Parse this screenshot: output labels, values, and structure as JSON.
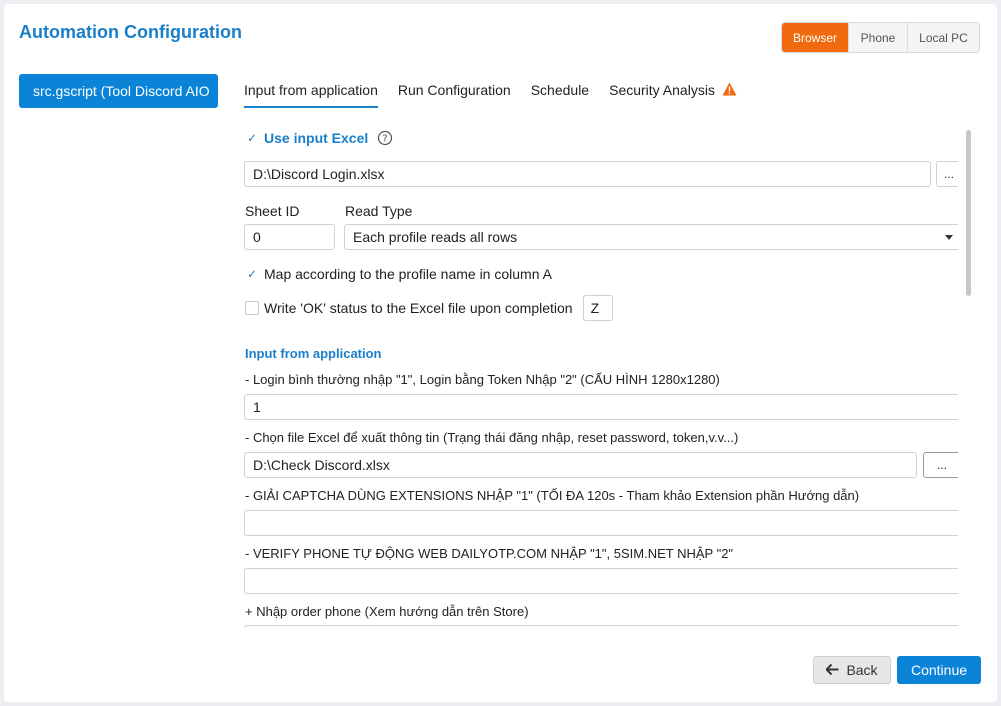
{
  "header": {
    "title": "Automation Configuration"
  },
  "env_tabs": [
    "Browser",
    "Phone",
    "Local PC"
  ],
  "env_active": "Browser",
  "script": {
    "name": "src.gscript  (Tool Discord AIO"
  },
  "tabs": [
    "Input from application",
    "Run Configuration",
    "Schedule",
    "Security Analysis"
  ],
  "excel": {
    "use_input_label": "Use input Excel",
    "file_path": "D:\\Discord Login.xlsx",
    "browse_label": "...",
    "sheet_id_label": "Sheet ID",
    "sheet_id_value": "0",
    "read_type_label": "Read Type",
    "read_type_value": "Each profile reads all rows",
    "map_label": "Map according to the profile name in column A",
    "write_ok_label": "Write 'OK' status to the Excel file upon completion",
    "write_ok_column": "Z"
  },
  "app_inputs": {
    "section_title": "Input from application",
    "fields": [
      {
        "label": "- Login bình thường nhập \"1\", Login bằng Token Nhập \"2\" (CẤU HÌNH 1280x1280)",
        "value": "1"
      },
      {
        "label": "- Chọn file Excel để xuất thông tin (Trạng thái đăng nhập, reset password, token,v.v...)",
        "value": "D:\\Check Discord.xlsx",
        "browse": "..."
      },
      {
        "label": "- GIẢI CAPTCHA DÙNG EXTENSIONS NHẬP \"1\" (TỐI ĐA 120s - Tham khảo Extension phần Hướng dẫn)",
        "value": ""
      },
      {
        "label": "- VERIFY PHONE TỰ ĐỘNG WEB DAILYOTP.COM NHẬP \"1\", 5SIM.NET NHẬP \"2\"",
        "value": ""
      },
      {
        "label": "+ Nhập order phone (Xem hướng dẫn trên Store)",
        "value": ""
      }
    ]
  },
  "footer": {
    "back_label": "Back",
    "continue_label": "Continue"
  },
  "colors": {
    "accent": "#1a7fc9",
    "primary_button": "#0b84d8",
    "active_env": "#f06a0f",
    "warning": "#f06a0f"
  }
}
